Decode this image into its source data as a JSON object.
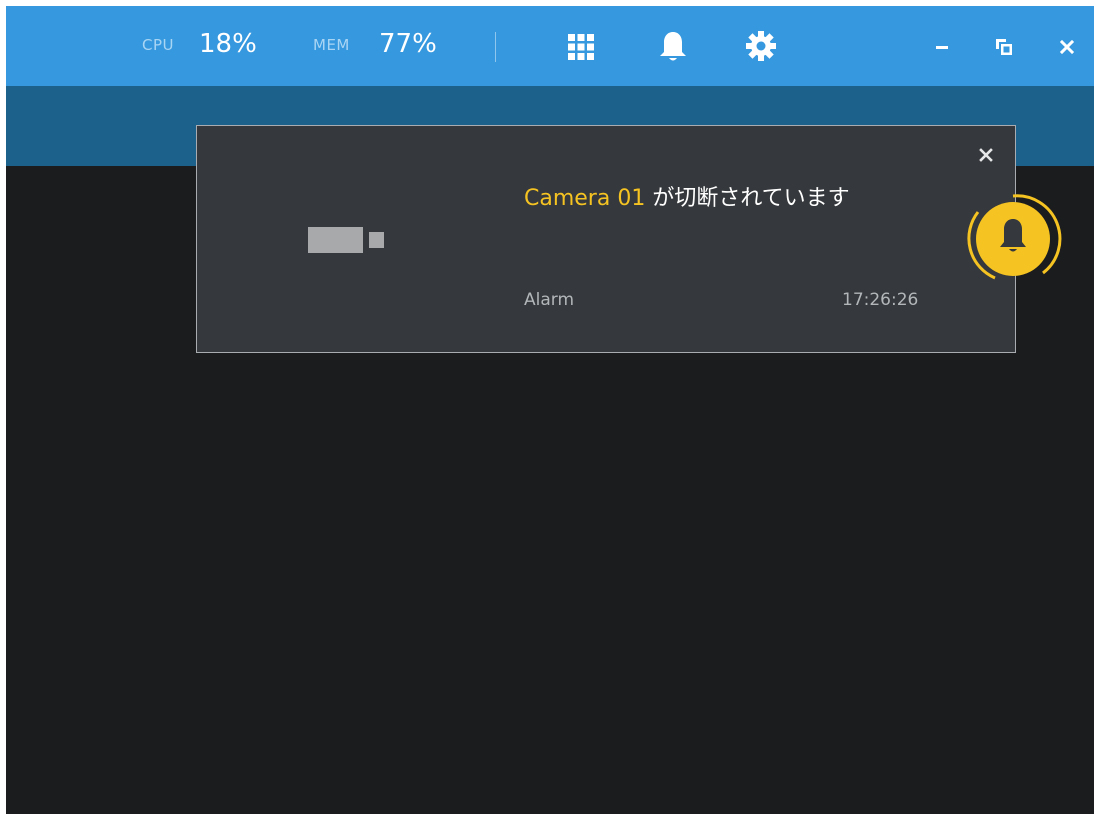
{
  "topbar": {
    "cpu_label": "CPU",
    "cpu_value": "18%",
    "mem_label": "MEM",
    "mem_value": "77%",
    "icons": {
      "grid": "grid-icon",
      "bell": "bell-icon",
      "settings": "gear-icon",
      "minimize": "minimize-icon",
      "restore": "restore-icon",
      "close": "close-icon"
    },
    "colors": {
      "bar": "#3698de",
      "subbar": "#1c608c"
    }
  },
  "notification": {
    "camera_name": "Camera 01",
    "message": " が切断されています",
    "type": "Alarm",
    "time": "17:26:26",
    "icon": "camera-icon",
    "close_icon": "close-icon",
    "accent_color": "#f5c322",
    "background": "#35383c"
  },
  "alarm_badge": {
    "icon": "bell-icon",
    "color": "#f5c322"
  }
}
